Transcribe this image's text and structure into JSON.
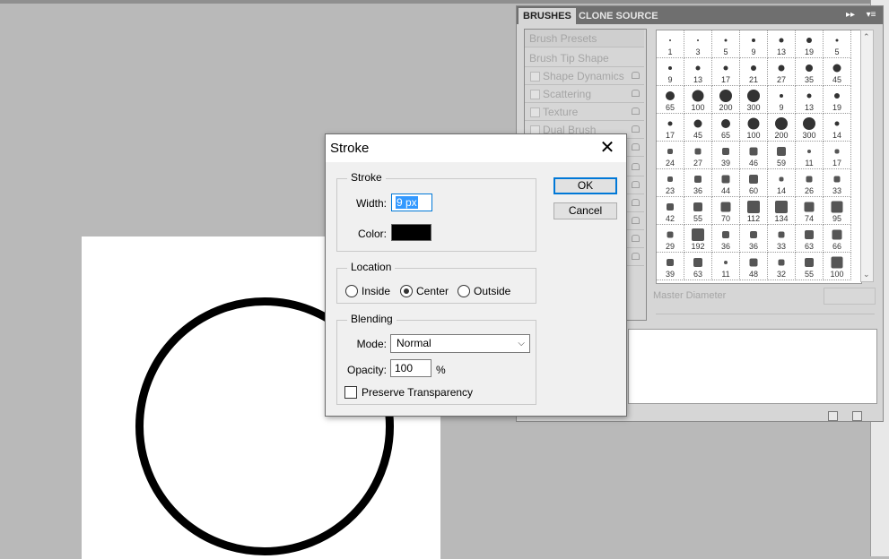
{
  "brushes_panel": {
    "tabs": [
      "BRUSHES",
      "CLONE SOURCE"
    ],
    "menu_glyph": "▸▸",
    "panel_menu_glyph": "▾≡",
    "options": [
      {
        "label": "Brush Presets",
        "checkbox": false
      },
      {
        "label": "Brush Tip Shape",
        "checkbox": false
      },
      {
        "label": "Shape Dynamics",
        "checkbox": true
      },
      {
        "label": "Scattering",
        "checkbox": true
      },
      {
        "label": "Texture",
        "checkbox": true
      },
      {
        "label": "Dual Brush",
        "checkbox": true
      }
    ],
    "brush_sizes": [
      [
        "1",
        "3",
        "5",
        "9",
        "13",
        "19",
        "5"
      ],
      [
        "9",
        "13",
        "17",
        "21",
        "27",
        "35",
        "45"
      ],
      [
        "65",
        "100",
        "200",
        "300",
        "9",
        "13",
        "19"
      ],
      [
        "17",
        "45",
        "65",
        "100",
        "200",
        "300",
        "14"
      ],
      [
        "24",
        "27",
        "39",
        "46",
        "59",
        "11",
        "17"
      ],
      [
        "23",
        "36",
        "44",
        "60",
        "14",
        "26",
        "33"
      ],
      [
        "42",
        "55",
        "70",
        "112",
        "134",
        "74",
        "95"
      ],
      [
        "29",
        "192",
        "36",
        "36",
        "33",
        "63",
        "66"
      ],
      [
        "39",
        "63",
        "11",
        "48",
        "32",
        "55",
        "100"
      ]
    ],
    "master_diameter_label": "Master Diameter",
    "scroll_up": "⌃",
    "scroll_down": "⌄"
  },
  "stroke_dialog": {
    "title": "Stroke",
    "close_glyph": "✕",
    "stroke_group": {
      "legend": "Stroke",
      "width_label": "Width:",
      "width_value": "9 px",
      "color_label": "Color:",
      "color_value": "#000000"
    },
    "location_group": {
      "legend": "Location",
      "options": [
        "Inside",
        "Center",
        "Outside"
      ],
      "selected": "Center"
    },
    "blending_group": {
      "legend": "Blending",
      "mode_label": "Mode:",
      "mode_value": "Normal",
      "opacity_label": "Opacity:",
      "opacity_value": "100",
      "opacity_unit": "%",
      "preserve_label": "Preserve  Transparency",
      "preserve_checked": false
    },
    "ok_label": "OK",
    "cancel_label": "Cancel"
  },
  "colors": {
    "focus_accent": "#0078d7",
    "selection": "#3399ff",
    "canvas_bg": "#b9b9b9"
  }
}
